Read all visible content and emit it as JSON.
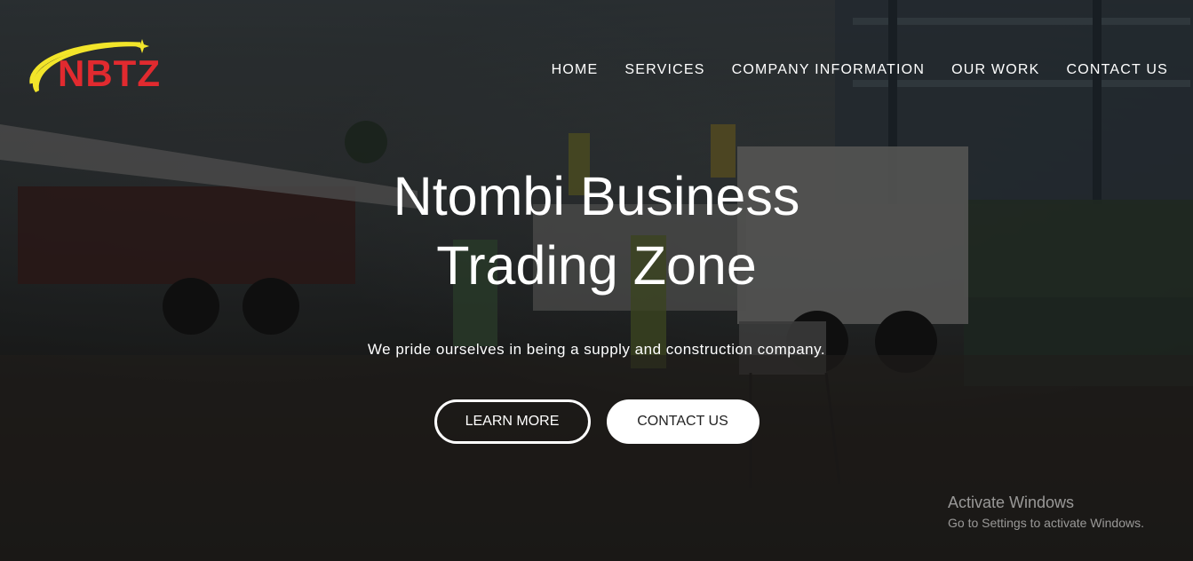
{
  "brand": {
    "logo_text": "NBTZ",
    "colors": {
      "logo_red": "#e12a2f",
      "logo_yellow": "#f2e52a"
    }
  },
  "nav": {
    "items": [
      {
        "label": "HOME"
      },
      {
        "label": "SERVICES"
      },
      {
        "label": "COMPANY INFORMATION"
      },
      {
        "label": "OUR WORK"
      },
      {
        "label": "CONTACT US"
      }
    ]
  },
  "hero": {
    "title_line1": "Ntombi Business",
    "title_line2": "Trading Zone",
    "subtitle": "We pride ourselves in being a supply and construction company.",
    "learn_more_label": "LEARN MORE",
    "contact_label": "CONTACT US"
  },
  "watermark": {
    "line1": "Activate Windows",
    "line2": "Go to Settings to activate Windows."
  }
}
